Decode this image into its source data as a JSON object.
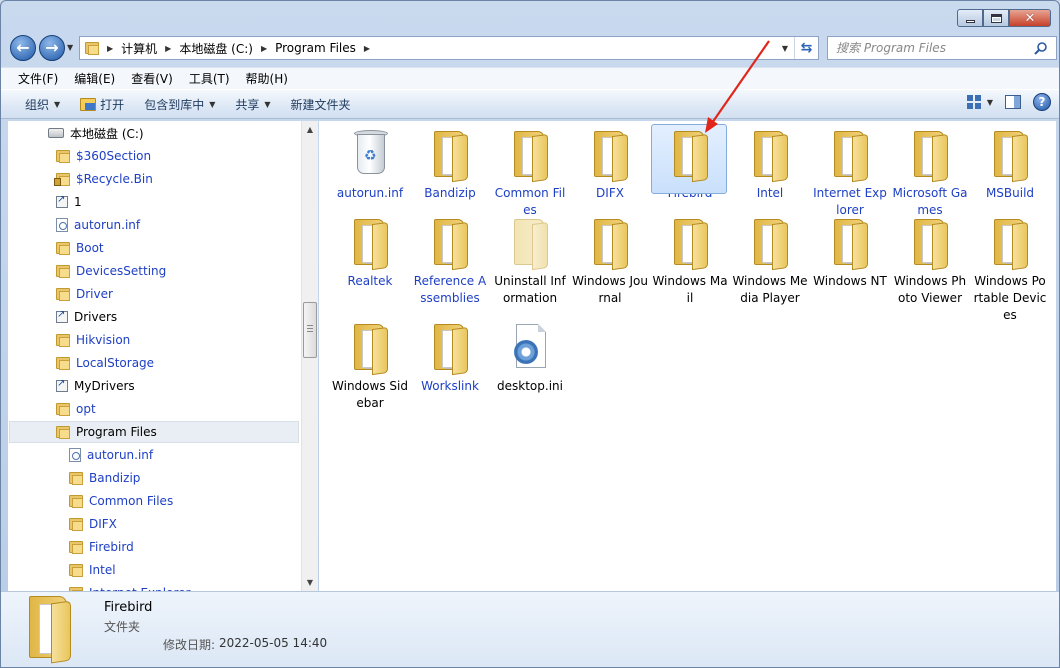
{
  "window": {
    "address_path": [
      "计算机",
      "本地磁盘 (C:)",
      "Program Files"
    ],
    "search_placeholder": "搜索 Program Files"
  },
  "menu": [
    "文件(F)",
    "编辑(E)",
    "查看(V)",
    "工具(T)",
    "帮助(H)"
  ],
  "toolbar": {
    "organize": "组织",
    "open": "打开",
    "include_in_library": "包含到库中",
    "share": "共享",
    "new_folder": "新建文件夹"
  },
  "nav_tree": [
    {
      "label": "本地磁盘 (C:)",
      "type": "drive"
    },
    {
      "label": "$360Section",
      "type": "folder"
    },
    {
      "label": "$Recycle.Bin",
      "type": "folder-locked"
    },
    {
      "label": "1",
      "type": "shortcut"
    },
    {
      "label": "autorun.inf",
      "type": "file"
    },
    {
      "label": "Boot",
      "type": "folder"
    },
    {
      "label": "DevicesSetting",
      "type": "folder"
    },
    {
      "label": "Driver",
      "type": "folder"
    },
    {
      "label": "Drivers",
      "type": "shortcut"
    },
    {
      "label": "Hikvision",
      "type": "folder"
    },
    {
      "label": "LocalStorage",
      "type": "folder"
    },
    {
      "label": "MyDrivers",
      "type": "shortcut"
    },
    {
      "label": "opt",
      "type": "folder"
    },
    {
      "label": "Program Files",
      "type": "folder",
      "selected": true
    },
    {
      "label": "autorun.inf",
      "type": "file",
      "child": true
    },
    {
      "label": "Bandizip",
      "type": "folder",
      "child": true
    },
    {
      "label": "Common Files",
      "type": "folder",
      "child": true
    },
    {
      "label": "DIFX",
      "type": "folder",
      "child": true
    },
    {
      "label": "Firebird",
      "type": "folder",
      "child": true
    },
    {
      "label": "Intel",
      "type": "folder",
      "child": true
    },
    {
      "label": "Internet Explorer",
      "type": "folder",
      "child": true
    }
  ],
  "items": [
    {
      "name": "autorun.inf",
      "icon": "recycle-bin-icon"
    },
    {
      "name": "Bandizip",
      "icon": "folder-icon"
    },
    {
      "name": "Common Files",
      "icon": "folder-icon"
    },
    {
      "name": "DIFX",
      "icon": "folder-icon"
    },
    {
      "name": "Firebird",
      "icon": "folder-icon",
      "selected": true
    },
    {
      "name": "Intel",
      "icon": "folder-icon"
    },
    {
      "name": "Internet Explorer",
      "icon": "folder-icon"
    },
    {
      "name": "Microsoft Games",
      "icon": "folder-icon"
    },
    {
      "name": "MSBuild",
      "icon": "folder-icon"
    },
    {
      "name": "Realtek",
      "icon": "folder-icon"
    },
    {
      "name": "Reference Assemblies",
      "icon": "folder-icon"
    },
    {
      "name": "Uninstall Information",
      "icon": "folder-hidden-icon"
    },
    {
      "name": "Windows Journal",
      "icon": "folder-icon"
    },
    {
      "name": "Windows Mail",
      "icon": "folder-icon"
    },
    {
      "name": "Windows Media Player",
      "icon": "folder-icon"
    },
    {
      "name": "Windows NT",
      "icon": "folder-icon"
    },
    {
      "name": "Windows Photo Viewer",
      "icon": "folder-icon"
    },
    {
      "name": "Windows Portable Devices",
      "icon": "folder-icon"
    },
    {
      "name": "Windows Sidebar",
      "icon": "folder-icon"
    },
    {
      "name": "Workslink",
      "icon": "folder-icon"
    },
    {
      "name": "desktop.ini",
      "icon": "settings-file-icon"
    }
  ],
  "details": {
    "name": "Firebird",
    "type": "文件夹",
    "modified_label": "修改日期:",
    "modified_value": "2022-05-05 14:40"
  },
  "colors": {
    "link_blue": "#1d3fc4",
    "annotation_red": "#e0261b"
  }
}
